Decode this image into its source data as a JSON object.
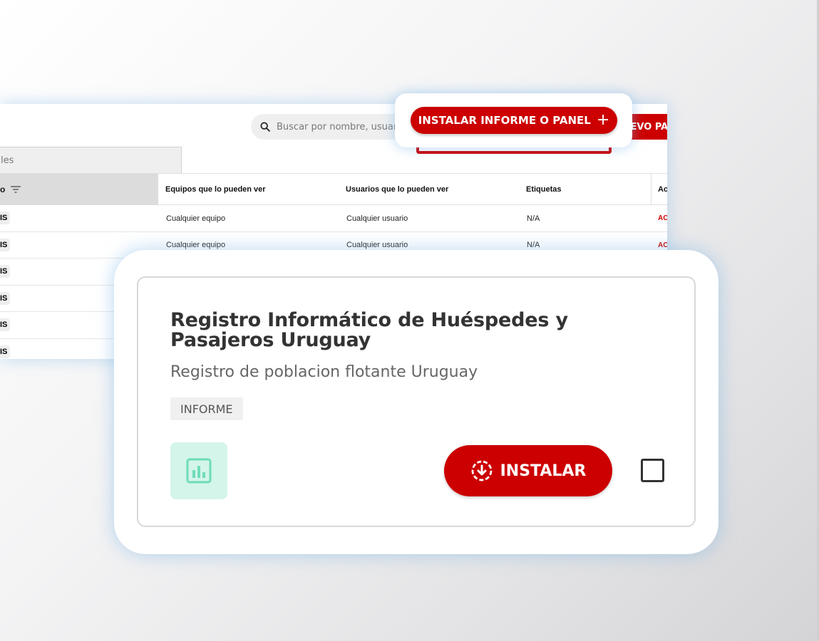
{
  "background_panel": {
    "search_placeholder": "Buscar por nombre, usuario",
    "new_button_label": "UEVO PA",
    "filter_tab_label": "les",
    "table": {
      "headers": [
        "o",
        "Equipos que lo pueden ver",
        "Usuarios que lo pueden ver",
        "Etiquetas",
        "Ac"
      ],
      "rows": [
        {
          "chip": "IS",
          "equipos": "Cualquier equipo",
          "usuarios": "Cualquier usuario",
          "etiquetas": "N/A",
          "accion": "AC"
        },
        {
          "chip": "IS",
          "equipos": "Cualquier equipo",
          "usuarios": "Cualquier usuario",
          "etiquetas": "N/A",
          "accion": "AC"
        },
        {
          "chip": "IS"
        },
        {
          "chip": "IS"
        },
        {
          "chip": "IS"
        },
        {
          "chip": "IS"
        }
      ]
    }
  },
  "top_card": {
    "install_label": "INSTALAR INFORME O PANEL",
    "plus": "+"
  },
  "main_card": {
    "title": "Registro Informático de Huéspedes y Pasajeros Uruguay",
    "subtitle": "Registro de poblacion flotante Uruguay",
    "tag": "INFORME",
    "install_label": "INSTALAR"
  },
  "colors": {
    "accent_red": "#cc0000",
    "tile_mint": "#d3f5ea",
    "tile_icon": "#6fdcb9"
  },
  "icons": [
    "search-icon",
    "filter-icon",
    "bar-chart-icon",
    "download-circle-icon",
    "plus-icon"
  ]
}
